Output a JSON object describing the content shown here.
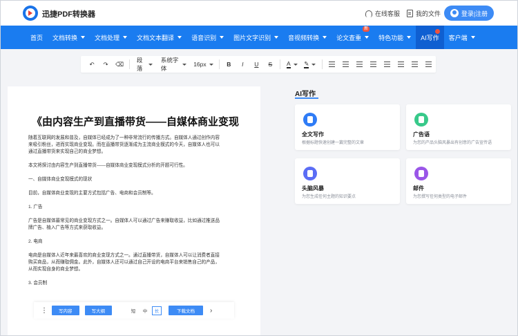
{
  "header": {
    "brand": "迅捷PDF转换器",
    "online_service": "在线客服",
    "my_files": "我的文件",
    "login": "登录|注册"
  },
  "nav": [
    {
      "label": "首页",
      "caret": false
    },
    {
      "label": "文档转换",
      "caret": true
    },
    {
      "label": "文档处理",
      "caret": true
    },
    {
      "label": "文档文本翻译",
      "caret": true
    },
    {
      "label": "语音识别",
      "caret": true
    },
    {
      "label": "图片文字识别",
      "caret": true
    },
    {
      "label": "音视频转换",
      "caret": true
    },
    {
      "label": "论文查重",
      "caret": true,
      "badge": "新"
    },
    {
      "label": "特色功能",
      "caret": true
    },
    {
      "label": "AI写作",
      "caret": false,
      "active": true
    },
    {
      "label": "客户端",
      "caret": true
    }
  ],
  "toolbar": {
    "undo": "↶",
    "redo": "↷",
    "clear_format": "⌫",
    "paragraph": "段落",
    "font": "系统字体",
    "size": "16px",
    "bold": "B",
    "italic": "I",
    "underline": "U",
    "strike": "S",
    "font_color": "A",
    "highlight": "✎"
  },
  "document": {
    "title": "《由内容生产到直播带货——自媒体商业变现",
    "paragraphs": [
      "随着互联网的发展和普及，自媒体已经成为了一种非常流行的传播方式。自媒体人通过创作内容",
      "来吸引粉丝，进而实现商业变现。而在直播带货逐渐成为主流商业模式的今天，自媒体人也可以",
      "通过直播带货来实现自己的商业梦想。",
      "本文将探讨由内容生产到直播带货——自媒体商业变现模式分析的开题可行性。",
      "一、自媒体商业变现模式的现状",
      "目前，自媒体商业变现的主要方式包括广告、电商和会员制等。",
      "1. 广告",
      "广告是自媒体最常见的商业变现方式之一。自媒体人可以通过广告来赚取收益，比如通过推送品",
      "牌广告、植入广告等方式来获取收益。",
      "2. 电商",
      "电商是自媒体人近年来最喜欢的商业变现方式之一。通过直播带货，自媒体人可以让消费者直接",
      "购买商品，从而赚取佣金。此外，自媒体人还可以通过自己开设的电商平台来销售自己的产品，",
      "从而实现自身的商业梦想。",
      "3. 会员制"
    ]
  },
  "bottom_bar": {
    "more": "⋮",
    "write_content": "写内容",
    "write_outline": "写大纲",
    "short": "短",
    "medium": "中",
    "long": "长",
    "download": "下载文档",
    "next": "›"
  },
  "ai_panel": {
    "title": "AI写作",
    "cards": [
      {
        "name": "全文写作",
        "desc": "根据标题快速创建一篇完整的文章",
        "color": "#2f7cf6"
      },
      {
        "name": "广告语",
        "desc": "为您的产品头脑风暴出有创意的广告宣传语",
        "color": "#38c98a"
      },
      {
        "name": "头脑风暴",
        "desc": "为您生成任何主题的知识要点",
        "color": "#5b6df5"
      },
      {
        "name": "邮件",
        "desc": "为您撰写任何类型的电子邮件",
        "color": "#9a56e8"
      }
    ]
  }
}
